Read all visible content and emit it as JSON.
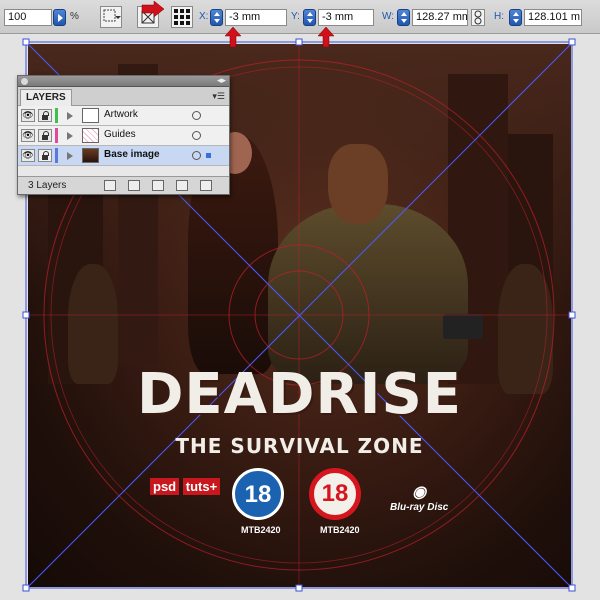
{
  "control_bar": {
    "opacity_value": "100",
    "opacity_unit": "%",
    "x_label": "X:",
    "x_value": "-3 mm",
    "y_label": "Y:",
    "y_value": "-3 mm",
    "w_label": "W:",
    "w_value": "128.27 mm",
    "h_label": "H:",
    "h_value": "128.101 m"
  },
  "layers_panel": {
    "tab_label": "LAYERS",
    "layer_count": "3 Layers",
    "layers": [
      {
        "name": "Artwork",
        "color": "#3cc04a",
        "selected": false
      },
      {
        "name": "Guides",
        "color": "#e04a9a",
        "selected": false
      },
      {
        "name": "Base image",
        "color": "#5a78e0",
        "selected": true
      }
    ]
  },
  "artwork": {
    "title": "DEADRISE",
    "subtitle": "THE SURVIVAL ZONE",
    "psd_logo": "psd",
    "tuts_logo": "tuts+",
    "rating_left": "18",
    "rating_right": "18",
    "code_left": "MTB2420",
    "code_right": "MTB2420",
    "bluray_text": "Blu-ray Disc"
  },
  "colors": {
    "accent_blue": "#1f56b0",
    "annotation_red": "#d0101a",
    "guide_blue": "#4a5cff",
    "guide_red": "#c0202a"
  }
}
